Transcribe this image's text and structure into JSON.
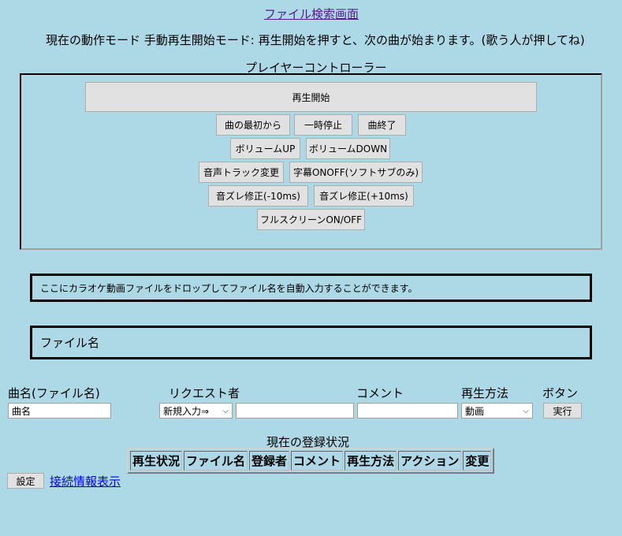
{
  "page": {
    "title_link": "ファイル検索画面",
    "mode_text": "現在の動作モード 手動再生開始モード: 再生開始を押すと、次の曲が始まります。(歌う人が押してね)"
  },
  "player": {
    "heading": "プレイヤーコントローラー",
    "start": "再生開始",
    "restart": "曲の最初から",
    "pause": "一時停止",
    "end": "曲終了",
    "vol_up": "ボリュームUP",
    "vol_down": "ボリュームDOWN",
    "audio_track": "音声トラック変更",
    "subtitle": "字幕ONOFF(ソフトサブのみ)",
    "sync_minus": "音ズレ修正(-10ms)",
    "sync_plus": "音ズレ修正(+10ms)",
    "fullscreen": "フルスクリーンON/OFF"
  },
  "dropzone": {
    "hint": "ここにカラオケ動画ファイルをドロップしてファイル名を自動入力することができます。",
    "filename_label": "ファイル名"
  },
  "form": {
    "headers": {
      "song": "曲名(ファイル名)",
      "requester": "リクエスト者",
      "comment": "コメント",
      "play_method": "再生方法",
      "button": "ボタン"
    },
    "song_value": "曲名",
    "requester_select": "新規入力⇒",
    "requester_input": "",
    "comment_input": "",
    "play_method_select": "動画",
    "run_button": "実行"
  },
  "registration": {
    "heading": "現在の登録状況",
    "columns": [
      "再生状況",
      "ファイル名",
      "登録者",
      "コメント",
      "再生方法",
      "アクション",
      "変更"
    ]
  },
  "footer": {
    "settings_button": "設定",
    "connection_link": "接続情報表示"
  }
}
